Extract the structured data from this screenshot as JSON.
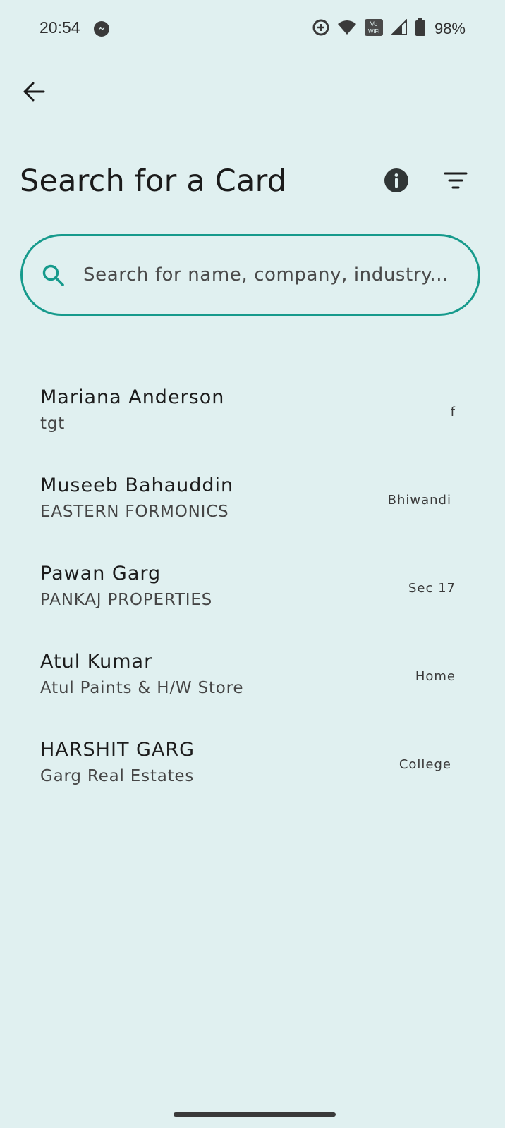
{
  "status_bar": {
    "time": "20:54",
    "battery_percent": "98%",
    "icons": [
      "messenger-icon",
      "data-saver-icon",
      "wifi-icon",
      "vowifi-icon",
      "signal-icon",
      "battery-icon"
    ],
    "vowifi_label_top": "Vo",
    "vowifi_label_bottom": "WiFi"
  },
  "header": {
    "back_icon": "arrow-back-icon",
    "title": "Search for a Card",
    "info_icon": "info-icon",
    "filter_icon": "filter-icon"
  },
  "search": {
    "icon": "search-icon",
    "placeholder": "Search for name, company, industry...",
    "value": ""
  },
  "cards": [
    {
      "name": "Mariana Anderson",
      "company": "tgt",
      "tag": "f"
    },
    {
      "name": "Museeb Bahauddin",
      "company": "EASTERN FORMONICS",
      "tag": "Bhiwandi"
    },
    {
      "name": "Pawan Garg",
      "company": "PANKAJ PROPERTIES",
      "tag": "Sec 17"
    },
    {
      "name": "Atul Kumar",
      "company": "Atul Paints & H/W Store",
      "tag": "Home"
    },
    {
      "name": "HARSHIT GARG",
      "company": "Garg Real Estates",
      "tag": "College"
    }
  ],
  "colors": {
    "background": "#e0f0f0",
    "accent": "#169a8c",
    "text_primary": "#1b1b1b",
    "text_secondary": "#454545"
  }
}
